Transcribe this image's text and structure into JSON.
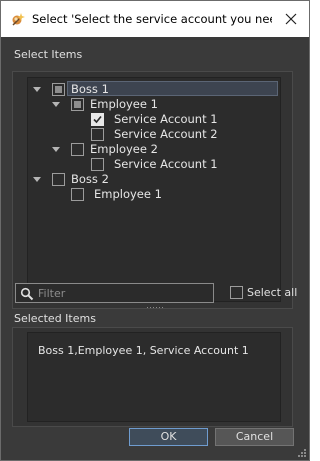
{
  "window": {
    "title": "Select 'Select the service account you need' ...",
    "icon": "wizard-app-icon",
    "close_icon": "close-icon"
  },
  "select_items": {
    "label": "Select Items",
    "tree": [
      {
        "label": "Boss 1",
        "level": 0,
        "expanded": true,
        "checkbox": "partial",
        "selected": true
      },
      {
        "label": "Employee 1",
        "level": 1,
        "expanded": true,
        "checkbox": "partial"
      },
      {
        "label": "Service Account 1",
        "level": 2,
        "checkbox": "checked"
      },
      {
        "label": "Service Account 2",
        "level": 2,
        "checkbox": "unchecked"
      },
      {
        "label": "Employee 2",
        "level": 1,
        "expanded": true,
        "checkbox": "unchecked"
      },
      {
        "label": "Service Account 1",
        "level": 2,
        "checkbox": "unchecked"
      },
      {
        "label": "Boss 2",
        "level": 0,
        "expanded": true,
        "checkbox": "unchecked"
      },
      {
        "label": "Employee 1",
        "level": 1,
        "checkbox": "unchecked"
      }
    ]
  },
  "filter": {
    "placeholder": "Filter",
    "value": "",
    "icon": "search-icon"
  },
  "select_all": {
    "label": "Select all",
    "checked": false
  },
  "selected_items": {
    "label": "Selected Items",
    "text": "Boss 1,Employee 1, Service Account 1"
  },
  "buttons": {
    "ok": "OK",
    "cancel": "Cancel"
  },
  "colors": {
    "background": "#3a3a3a",
    "panel": "#2c2c2c",
    "text": "#e6e6e6",
    "ok_border": "#6f9ccf"
  }
}
